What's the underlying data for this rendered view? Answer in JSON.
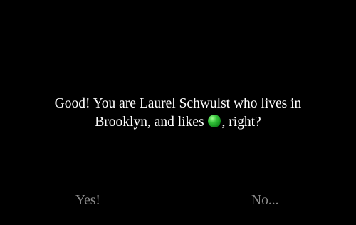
{
  "dialog": {
    "line1": "Good! You are Laurel Schwulst who lives in",
    "line2_before": "Brooklyn, and likes ",
    "line2_after": ", right?",
    "liked_item_icon": "green-ball-icon",
    "liked_item_color": "#2db534"
  },
  "answers": {
    "yes_label": "Yes!",
    "no_label": "No...",
    "label_color": "#8a8a8a"
  },
  "background_color": "#000000",
  "text_color": "#ffffff"
}
